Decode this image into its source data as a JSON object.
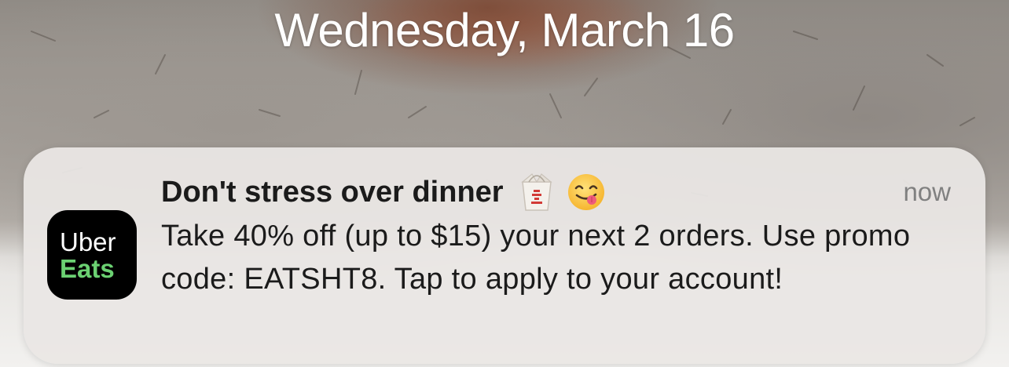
{
  "lockscreen": {
    "date": "Wednesday, March 16"
  },
  "notification": {
    "app_icon": {
      "line1": "Uber",
      "line2": "Eats",
      "line1_color": "#ffffff",
      "line2_color": "#6bd172",
      "background": "#000000"
    },
    "title": "Don't stress over dinner",
    "title_emojis": [
      "takeout-box-icon",
      "face-savoring-food-icon"
    ],
    "time": "now",
    "body": "Take 40% off (up to $15) your next 2 orders. Use promo code: EATSHT8. Tap to apply to your account!"
  }
}
